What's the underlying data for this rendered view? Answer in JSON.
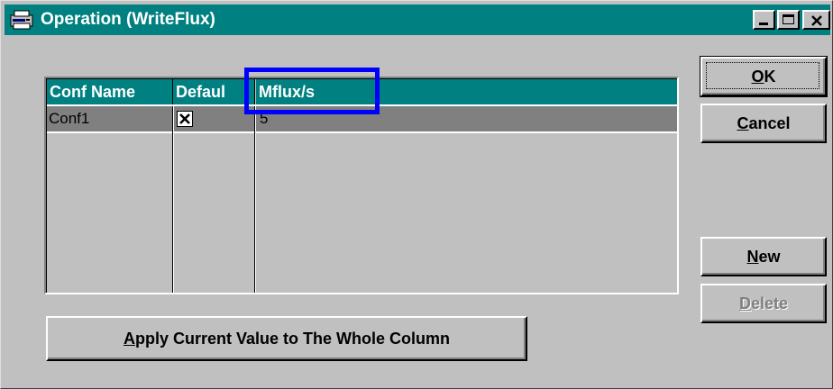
{
  "window": {
    "title": "Operation (WriteFlux)",
    "icon": "printer-window-icon",
    "controls": {
      "minimize_icon": "minimize-icon",
      "maximize_icon": "maximize-icon",
      "close_icon": "close-icon"
    }
  },
  "grid": {
    "columns": [
      "Conf Name",
      "Defaul",
      "Mflux/s"
    ],
    "rows": [
      {
        "conf_name": "Conf1",
        "default_checked": true,
        "mflux": "5"
      }
    ]
  },
  "buttons": {
    "ok": {
      "pre": "",
      "mnemonic": "O",
      "post": "K"
    },
    "cancel": {
      "pre": "",
      "mnemonic": "C",
      "post": "ancel"
    },
    "new": {
      "pre": "",
      "mnemonic": "N",
      "post": "ew"
    },
    "delete": {
      "pre": "",
      "mnemonic": "D",
      "post": "elete"
    },
    "apply": {
      "pre": "",
      "mnemonic": "A",
      "post": "pply Current Value to The Whole Column"
    }
  },
  "colors": {
    "title_bar": "#008080",
    "face": "#c0c0c0",
    "highlight_box": "#0000ff",
    "selected_row": "#808080"
  }
}
